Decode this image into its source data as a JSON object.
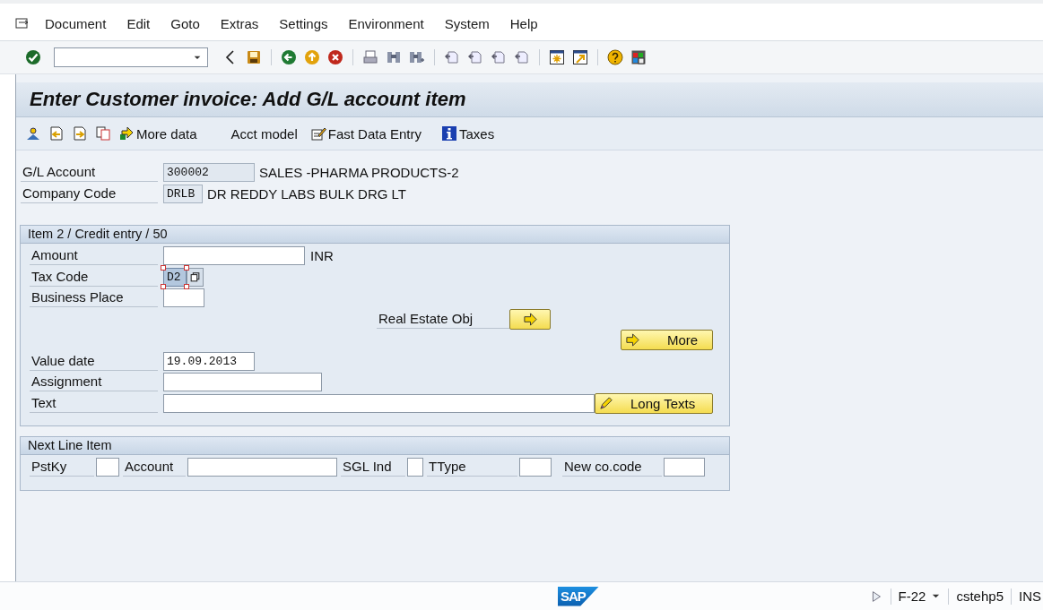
{
  "menu": [
    {
      "label": "Document"
    },
    {
      "label": "Edit"
    },
    {
      "label": "Goto"
    },
    {
      "label": "Extras"
    },
    {
      "label": "Settings"
    },
    {
      "label": "Environment"
    },
    {
      "label": "System"
    },
    {
      "label": "Help"
    }
  ],
  "title": "Enter Customer invoice: Add G/L account item",
  "app_toolbar": {
    "more_data": "More data",
    "acct_model": "Acct model",
    "fast_data_entry": "Fast Data Entry",
    "taxes": "Taxes"
  },
  "header_fields": [
    {
      "label": "G/L Account",
      "value": "300002",
      "description": "SALES -PHARMA PRODUCTS-2"
    },
    {
      "label": "Company Code",
      "value": "DRLB",
      "description": "DR REDDY LABS BULK DRG LT"
    }
  ],
  "item": {
    "title": "Item 2 / Credit entry / 50",
    "amount": {
      "label": "Amount",
      "unit": "INR"
    },
    "tax_code": {
      "label": "Tax Code",
      "value": "D2",
      "selected": true
    },
    "business_place": {
      "label": "Business Place"
    },
    "real_estate": {
      "label": "Real Estate Obj"
    },
    "more_button": "More",
    "value_date": {
      "label": "Value date",
      "value": "19.09.2013"
    },
    "assignment": {
      "label": "Assignment"
    },
    "text": {
      "label": "Text"
    },
    "long_texts_button": "Long Texts"
  },
  "next_line": {
    "title": "Next Line Item",
    "fields": [
      {
        "label": "PstKy"
      },
      {
        "label": "Account"
      },
      {
        "label": "SGL Ind"
      },
      {
        "label": "TType"
      },
      {
        "label": "New co.code"
      }
    ]
  },
  "status_bar": {
    "logo": "SAP",
    "transaction": "F-22",
    "server": "cstehp5",
    "mode": "INS"
  }
}
